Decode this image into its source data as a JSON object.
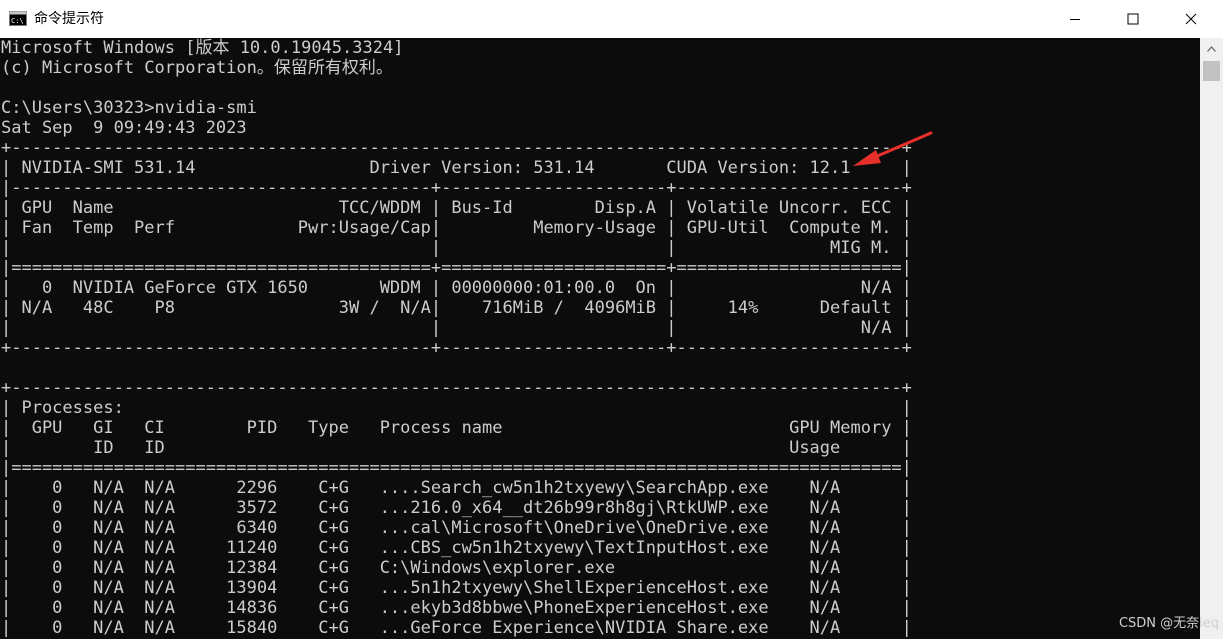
{
  "window": {
    "title": "命令提示符",
    "icon": "cmd-icon"
  },
  "controls": {
    "minimize": "minimize-icon",
    "maximize": "maximize-icon",
    "close": "close-icon"
  },
  "console": {
    "lines": [
      "Microsoft Windows [版本 10.0.19045.3324]",
      "(c) Microsoft Corporation。保留所有权利。",
      "",
      "C:\\Users\\30323>nvidia-smi",
      "Sat Sep  9 09:49:43 2023",
      "+---------------------------------------------------------------------------------------+",
      "| NVIDIA-SMI 531.14                 Driver Version: 531.14       CUDA Version: 12.1     |",
      "|-----------------------------------------+----------------------+----------------------+",
      "| GPU  Name                      TCC/WDDM | Bus-Id        Disp.A | Volatile Uncorr. ECC |",
      "| Fan  Temp  Perf            Pwr:Usage/Cap|         Memory-Usage | GPU-Util  Compute M. |",
      "|                                         |                      |               MIG M. |",
      "|=========================================+======================+======================|",
      "|   0  NVIDIA GeForce GTX 1650       WDDM | 00000000:01:00.0  On |                  N/A |",
      "| N/A   48C    P8                3W /  N/A|    716MiB /  4096MiB |     14%      Default |",
      "|                                         |                      |                  N/A |",
      "+-----------------------------------------+----------------------+----------------------+",
      "",
      "+---------------------------------------------------------------------------------------+",
      "| Processes:                                                                            |",
      "|  GPU   GI   CI        PID   Type   Process name                            GPU Memory |",
      "|        ID   ID                                                             Usage      |",
      "|=======================================================================================|",
      "|    0   N/A  N/A      2296    C+G   ....Search_cw5n1h2txyewy\\SearchApp.exe    N/A      |",
      "|    0   N/A  N/A      3572    C+G   ...216.0_x64__dt26b99r8h8gj\\RtkUWP.exe    N/A      |",
      "|    0   N/A  N/A      6340    C+G   ...cal\\Microsoft\\OneDrive\\OneDrive.exe    N/A      |",
      "|    0   N/A  N/A     11240    C+G   ...CBS_cw5n1h2txyewy\\TextInputHost.exe    N/A      |",
      "|    0   N/A  N/A     12384    C+G   C:\\Windows\\explorer.exe                   N/A      |",
      "|    0   N/A  N/A     13904    C+G   ...5n1h2txyewy\\ShellExperienceHost.exe    N/A      |",
      "|    0   N/A  N/A     14836    C+G   ...ekyb3d8bbwe\\PhoneExperienceHost.exe    N/A      |",
      "|    0   N/A  N/A     15840    C+G   ...GeForce Experience\\NVIDIA Share.exe    N/A      |"
    ]
  },
  "annotation": {
    "arrow_color": "#e8302a"
  },
  "watermark": "CSDN @无奈ieq"
}
